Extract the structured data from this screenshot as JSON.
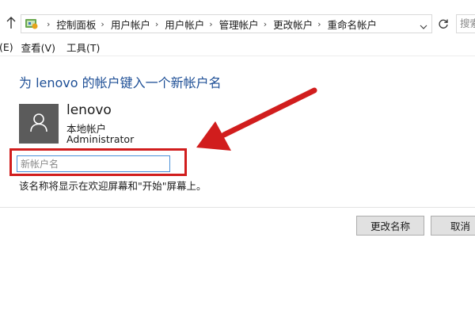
{
  "address_bar": {
    "breadcrumbs": [
      "控制面板",
      "用户帐户",
      "用户帐户",
      "管理帐户",
      "更改帐户",
      "重命名帐户"
    ],
    "search_placeholder": "搜索"
  },
  "menubar": {
    "items": [
      "(E)",
      "查看(V)",
      "工具(T)"
    ]
  },
  "content": {
    "title": "为 lenovo 的帐户键入一个新帐户名",
    "account": {
      "name": "lenovo",
      "type": "本地帐户",
      "group": "Administrator"
    },
    "new_name_input": {
      "value": "",
      "placeholder": "新帐户名"
    },
    "hint": "该名称将显示在欢迎屏幕和\"开始\"屏幕上。"
  },
  "buttons": {
    "rename": "更改名称",
    "cancel": "取消"
  },
  "colors": {
    "title_blue": "#1e4f96",
    "annotation_red": "#d11d1d",
    "avatar_gray": "#5b5b5b",
    "input_focus_border": "#4a90d9"
  },
  "icons": {
    "up": "up-arrow-icon",
    "location": "control-panel-icon",
    "refresh": "refresh-icon",
    "avatar": "user-silhouette-icon"
  }
}
